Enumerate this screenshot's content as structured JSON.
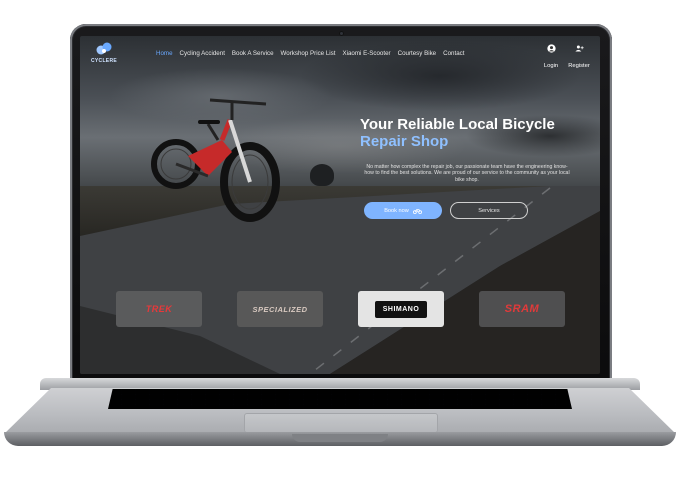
{
  "logo": {
    "text": "CYCLERE"
  },
  "nav": {
    "items": [
      {
        "label": "Home",
        "active": true
      },
      {
        "label": "Cycling Accident",
        "active": false
      },
      {
        "label": "Book A Service",
        "active": false
      },
      {
        "label": "Workshop Price List",
        "active": false
      },
      {
        "label": "Xiaomi E-Scooter",
        "active": false
      },
      {
        "label": "Courtesy Bike",
        "active": false
      },
      {
        "label": "Contact",
        "active": false
      }
    ],
    "login_label": "Login",
    "register_label": "Register"
  },
  "hero": {
    "title": "Your Reliable Local Bicycle",
    "subtitle": "Repair Shop",
    "description": "No matter how complex the repair job, our passionate team have the engineering know-how to find the best solutions. We are proud of our service to the community as your local bike shop.",
    "book_button_label": "Book now",
    "services_button_label": "Services"
  },
  "brands": [
    {
      "name": "TREK",
      "color": "#e8383a"
    },
    {
      "name": "SPECIALIZED",
      "color": "#d8c9c0"
    },
    {
      "name": "SHIMANO",
      "color": "#ffffff"
    },
    {
      "name": "SRAM",
      "color": "#e23a3a"
    }
  ],
  "colors": {
    "accent": "#6aa9ff",
    "button": "#7fb4ff",
    "bike_frame": "#c62a2a"
  }
}
